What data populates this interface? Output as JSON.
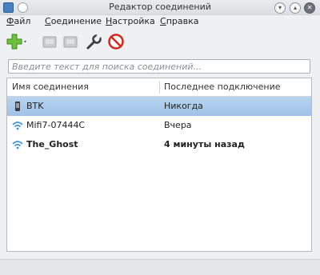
{
  "window": {
    "title": "Редактор соединений"
  },
  "menubar": {
    "items": [
      {
        "label": "Файл",
        "accel": "Ф",
        "rest": "айл"
      },
      {
        "label": "Соединение",
        "accel": "С",
        "rest": "оединение"
      },
      {
        "label": "Настройка",
        "accel": "Н",
        "rest": "астройка"
      },
      {
        "label": "Справка",
        "accel": "С",
        "rest": "правка"
      }
    ]
  },
  "toolbar": {
    "buttons": [
      "add-icon",
      "edit-icon",
      "copy-icon",
      "wrench-icon",
      "stop-icon"
    ],
    "colors": {
      "add": "#6cc23a",
      "stop": "#d6261c"
    }
  },
  "search": {
    "placeholder": "Введите текст для поиска соединений...",
    "value": ""
  },
  "table": {
    "columns": [
      "Имя соединения",
      "Последнее подключение"
    ],
    "rows": [
      {
        "name": "BTK",
        "last": "Никогда",
        "icon": "modem-icon",
        "selected": true,
        "bold": false
      },
      {
        "name": "Mifi7-07444C",
        "last": "Вчера",
        "icon": "wifi-icon",
        "selected": false,
        "bold": false
      },
      {
        "name": "The_Ghost",
        "last": "4 минуты назад",
        "icon": "wifi-icon",
        "selected": false,
        "bold": true
      }
    ]
  },
  "colors": {
    "selection": "#a9cbee",
    "wifi": "#3b8fd8"
  }
}
